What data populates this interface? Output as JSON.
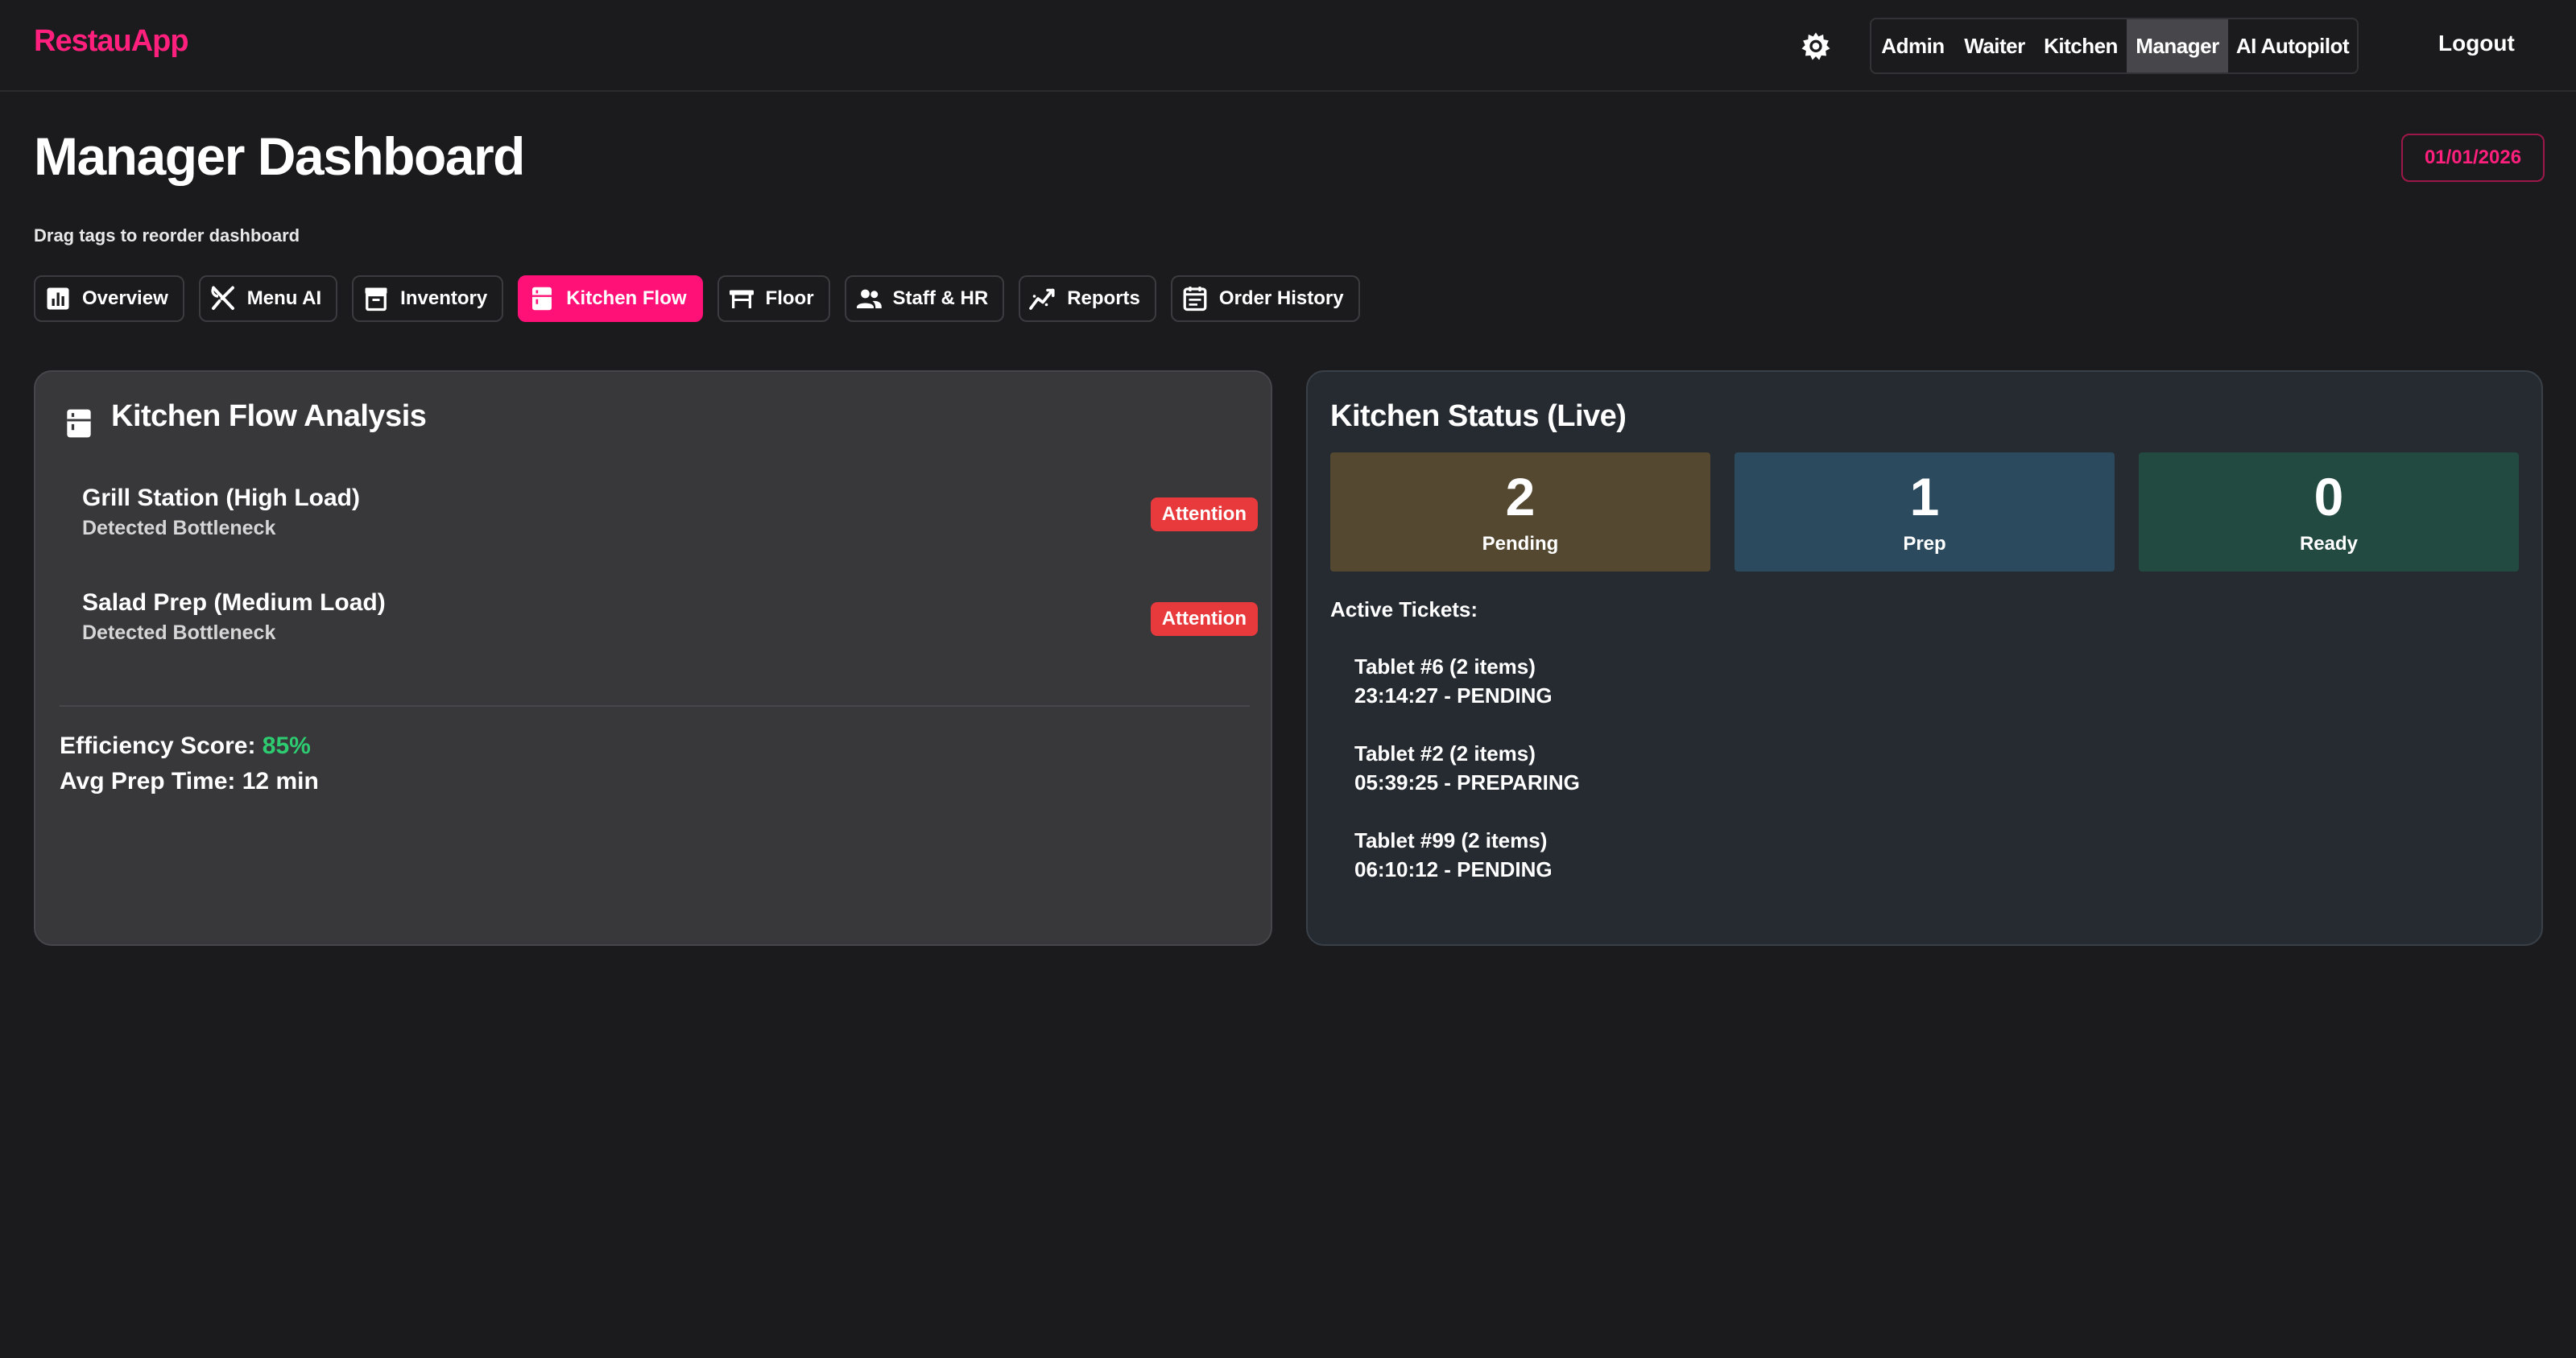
{
  "app": {
    "brand": "RestauApp"
  },
  "nav": {
    "roles": [
      {
        "label": "Admin",
        "active": false
      },
      {
        "label": "Waiter",
        "active": false
      },
      {
        "label": "Kitchen",
        "active": false
      },
      {
        "label": "Manager",
        "active": true
      },
      {
        "label": "AI Autopilot",
        "active": false
      }
    ],
    "logout_label": "Logout"
  },
  "header": {
    "title": "Manager Dashboard",
    "date": "01/01/2026",
    "hint": "Drag tags to reorder dashboard"
  },
  "tabs": [
    {
      "label": "Overview",
      "icon": "bar-chart-icon",
      "active": false
    },
    {
      "label": "Menu AI",
      "icon": "fork-knife-icon",
      "active": false
    },
    {
      "label": "Inventory",
      "icon": "archive-box-icon",
      "active": false
    },
    {
      "label": "Kitchen Flow",
      "icon": "fridge-icon",
      "active": true
    },
    {
      "label": "Floor",
      "icon": "table-icon",
      "active": false
    },
    {
      "label": "Staff & HR",
      "icon": "people-icon",
      "active": false
    },
    {
      "label": "Reports",
      "icon": "trend-line-icon",
      "active": false
    },
    {
      "label": "Order History",
      "icon": "calendar-list-icon",
      "active": false
    }
  ],
  "kitchen_flow": {
    "title": "Kitchen Flow Analysis",
    "bottlenecks": [
      {
        "name": "Grill Station (High Load)",
        "sub": "Detected Bottleneck",
        "badge": "Attention"
      },
      {
        "name": "Salad Prep (Medium Load)",
        "sub": "Detected Bottleneck",
        "badge": "Attention"
      }
    ],
    "efficiency_label": "Efficiency Score:",
    "efficiency_value": "85%",
    "avg_prep_label": "Avg Prep Time:",
    "avg_prep_value": "12 min"
  },
  "kitchen_status": {
    "title": "Kitchen Status (Live)",
    "counters": [
      {
        "count": "2",
        "label": "Pending",
        "color": "#544830"
      },
      {
        "count": "1",
        "label": "Prep",
        "color": "#2b4a5e"
      },
      {
        "count": "0",
        "label": "Ready",
        "color": "#234a41"
      }
    ],
    "active_label": "Active Tickets:",
    "tickets": [
      {
        "title": "Tablet #6 (2 items)",
        "detail": "23:14:27 - PENDING"
      },
      {
        "title": "Tablet #2 (2 items)",
        "detail": "05:39:25 - PREPARING"
      },
      {
        "title": "Tablet #99 (2 items)",
        "detail": "06:10:12 - PENDING"
      }
    ]
  },
  "colors": {
    "accent": "#ff1178",
    "danger": "#e8393d",
    "success": "#2ecc71"
  }
}
